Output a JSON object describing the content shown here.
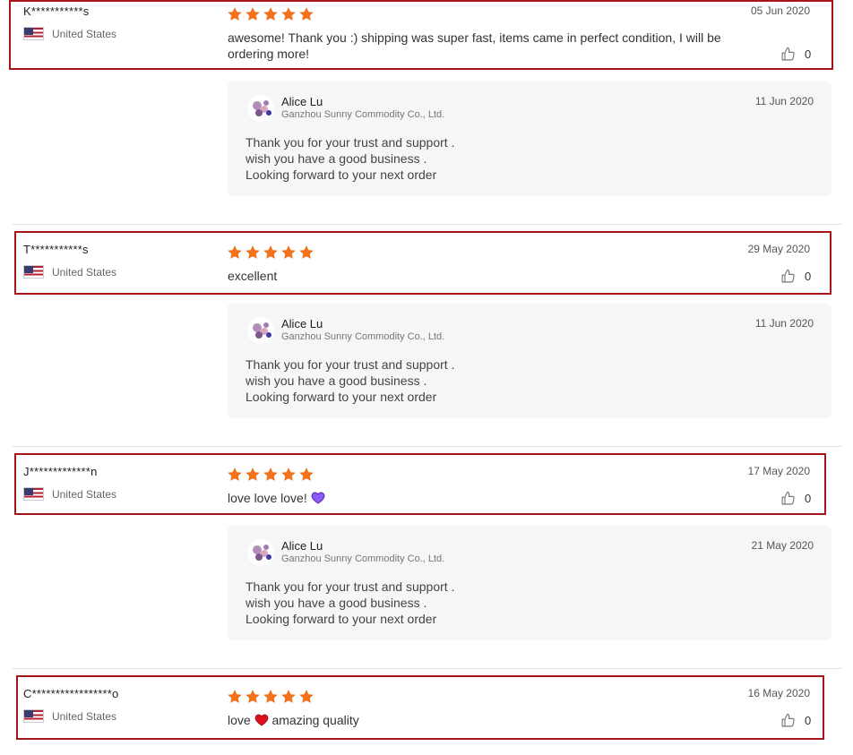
{
  "reviews": [
    {
      "name": "K***********s",
      "country": "United States",
      "rating": 5,
      "text": "awesome! Thank you :) shipping was super fast, items came in perfect condition, I will be ordering more!",
      "date": "05 Jun 2020",
      "likes": "0",
      "reply": {
        "seller": "Alice Lu",
        "company": "Ganzhou Sunny Commodity Co., Ltd.",
        "date": "11 Jun 2020",
        "lines": [
          "Thank you for your trust and support .",
          "wish you have a good business .",
          "Looking forward to your next order"
        ]
      }
    },
    {
      "name": "T***********s",
      "country": "United States",
      "rating": 5,
      "text": "excellent",
      "date": "29 May 2020",
      "likes": "0",
      "reply": {
        "seller": "Alice Lu",
        "company": "Ganzhou Sunny Commodity Co., Ltd.",
        "date": "11 Jun 2020",
        "lines": [
          "Thank you for your trust and support .",
          "wish you have a good business .",
          "Looking forward to your next order"
        ]
      }
    },
    {
      "name": "J*************n",
      "country": "United States",
      "rating": 5,
      "text": "love love love!",
      "emoji": "purple-heart",
      "date": "17 May 2020",
      "likes": "0",
      "reply": {
        "seller": "Alice Lu",
        "company": "Ganzhou Sunny Commodity Co., Ltd.",
        "date": "21 May 2020",
        "lines": [
          "Thank you for your trust and support .",
          "wish you have a good business .",
          "Looking forward to your next order"
        ]
      }
    },
    {
      "name": "C*****************o",
      "country": "United States",
      "rating": 5,
      "text_before": "love",
      "emoji": "red-heart",
      "text_after": "amazing quality",
      "date": "16 May 2020",
      "likes": "0"
    }
  ],
  "colors": {
    "star": "#f2711c",
    "highlight_box": "#a4161a",
    "reply_bg": "#f5f6f8",
    "purple_heart": "#8b5cf6",
    "red_heart": "#e0101e"
  }
}
